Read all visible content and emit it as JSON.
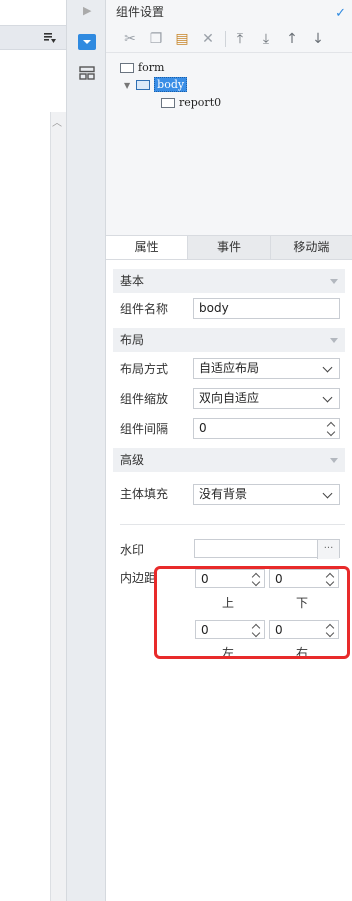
{
  "panel": {
    "title": "组件设置",
    "toolbar_icons": [
      "cut-icon",
      "copy-icon",
      "paste-icon",
      "delete-icon",
      "move-top-icon",
      "move-bottom-icon",
      "move-up-icon",
      "move-down-icon"
    ]
  },
  "tree": {
    "root": "form",
    "child": "body",
    "grandchild": "report0"
  },
  "tabs": [
    "属性",
    "事件",
    "移动端"
  ],
  "props": {
    "basic_section": "基本",
    "widget_name_label": "组件名称",
    "widget_name_value": "body",
    "layout_section": "布局",
    "layout_mode_label": "布局方式",
    "layout_mode_value": "自适应布局",
    "scale_label": "组件缩放",
    "scale_value": "双向自适应",
    "spacing_label": "组件间隔",
    "spacing_value": "0",
    "advanced_section": "高级",
    "fill_label": "主体填充",
    "fill_value": "没有背景",
    "watermark_label": "水印",
    "watermark_value": "",
    "watermark_more": "···",
    "padding_label": "内边距",
    "padding": {
      "top_value": "0",
      "top_label": "上",
      "bottom_value": "0",
      "bottom_label": "下",
      "left_value": "0",
      "left_label": "左",
      "right_value": "0",
      "right_label": "右"
    }
  },
  "colors": {
    "accent": "#2f8ae0",
    "highlight_border": "#e82a2a",
    "panel_bg": "#f5f6f8"
  }
}
